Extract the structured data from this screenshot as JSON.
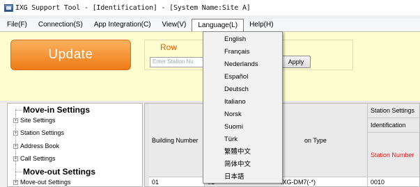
{
  "window": {
    "title": "IXG Support Tool - [Identification] - [System Name:Site A]"
  },
  "menu": {
    "items": [
      {
        "label": "File(F)"
      },
      {
        "label": "Connection(S)"
      },
      {
        "label": "App Integration(C)"
      },
      {
        "label": "View(V)"
      },
      {
        "label": "Language(L)"
      },
      {
        "label": "Help(H)"
      }
    ]
  },
  "toolbar": {
    "update_label": "Update",
    "row_label": "Row",
    "station_placeholder": "Enter Station Nu",
    "apply_label": "Apply"
  },
  "tree": {
    "move_in_heading": "Move-in Settings",
    "move_in_items": [
      "Site Settings",
      "Station Settings",
      "Address Book",
      "Call Settings"
    ],
    "move_out_heading": "Move-out Settings",
    "move_out_items": [
      "Move-out Settings"
    ],
    "expander_glyph": "+"
  },
  "grid": {
    "building_number_header": "Building Number",
    "station_type_header": "on Type",
    "station_settings_header": "Station Settings",
    "identification_header": "Identification",
    "station_number_header": "Station Number",
    "row1_building": "01",
    "row1_col2": "01",
    "row1_type": "IXG-DM7(-*)",
    "row1_station_number": "0010"
  },
  "language_menu": {
    "items": [
      "English",
      "Français",
      "Nederlands",
      "Español",
      "Deutsch",
      "Italiano",
      "Norsk",
      "Suomi",
      "Türk",
      "繁體中文",
      "简体中文",
      "日本語"
    ]
  },
  "colors": {
    "accent_orange": "#f07b16",
    "row_label": "#e05a00",
    "station_number_red": "#e31a1a",
    "toolbar_bg": "#fdfdd0"
  }
}
